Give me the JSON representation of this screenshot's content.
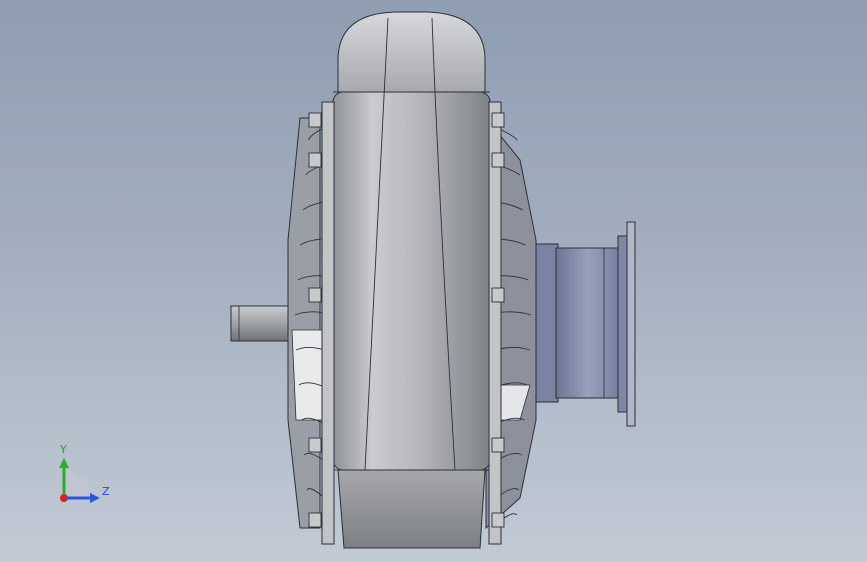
{
  "viewport": {
    "background": "#a3afc0"
  },
  "triad": {
    "y_label": "Y",
    "z_label": "Z",
    "colors": {
      "y": "#2eaa2e",
      "z": "#2a56d8",
      "x": "#d22424"
    }
  },
  "model": {
    "part_colors": {
      "body": "#b7b9bd",
      "rib": "#8b8f98",
      "flange": "#8f96b4",
      "shaft": "#a4a7ab",
      "bolt": "#c8c9cb",
      "edge": "#2b2f38"
    }
  }
}
